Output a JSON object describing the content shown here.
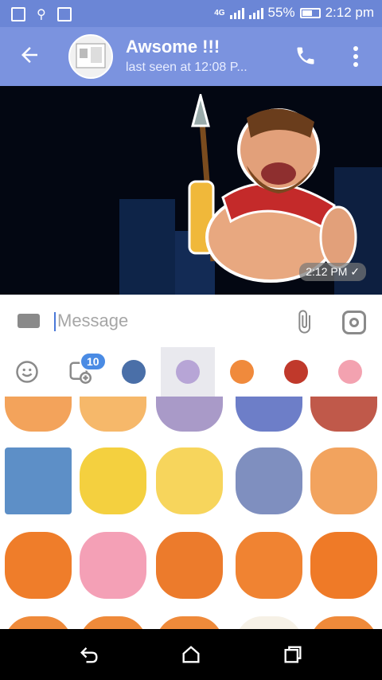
{
  "status_bar": {
    "network": "4G",
    "battery": "55%",
    "time": "2:12 pm"
  },
  "header": {
    "title": "Awsome !!!",
    "subtitle": "last seen at 12:08 P..."
  },
  "message": {
    "time": "2:12 PM"
  },
  "input": {
    "placeholder": "Message"
  },
  "sticker_tabs": {
    "badge": "10"
  },
  "colors": {
    "header": "#7b93df",
    "statusbar": "#6b86d6",
    "badge": "#4a8be4"
  }
}
